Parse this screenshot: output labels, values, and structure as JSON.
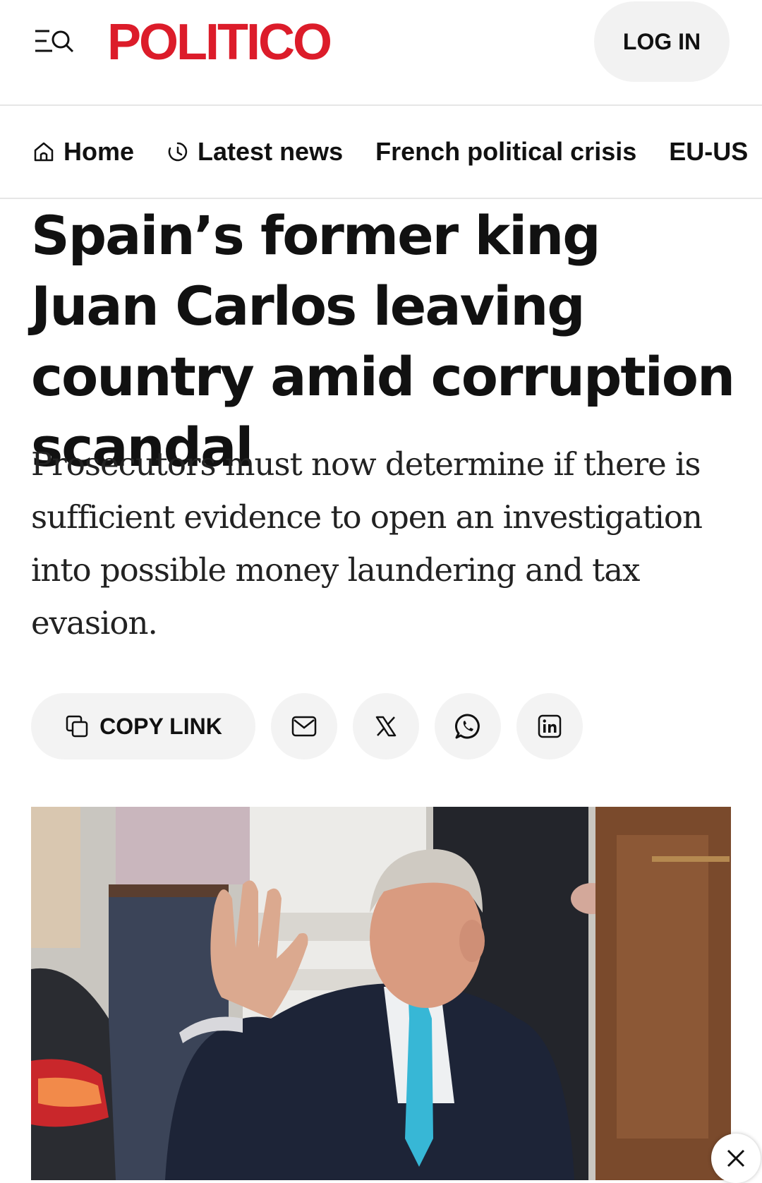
{
  "header": {
    "logo": "POLITICO",
    "login_label": "LOG IN",
    "menu_icon": "menu-search-icon"
  },
  "nav": {
    "items": [
      {
        "label": "Home",
        "icon": "home-icon"
      },
      {
        "label": "Latest news",
        "icon": "clock-icon"
      },
      {
        "label": "French political crisis"
      },
      {
        "label": "EU-US"
      }
    ]
  },
  "article": {
    "headline": "Spain’s former king Juan Carlos leaving country amid corruption scandal",
    "dek": "Prosecutors must now determine if there is sufficient evidence to open an investigation into possible money laundering and tax evasion."
  },
  "share": {
    "copy_link_label": "COPY LINK",
    "buttons": [
      "mail-icon",
      "x-icon",
      "whatsapp-icon",
      "linkedin-icon"
    ]
  },
  "colors": {
    "brand": "#dc1c2a",
    "pill_bg": "#f3f3f3",
    "text": "#111111"
  }
}
